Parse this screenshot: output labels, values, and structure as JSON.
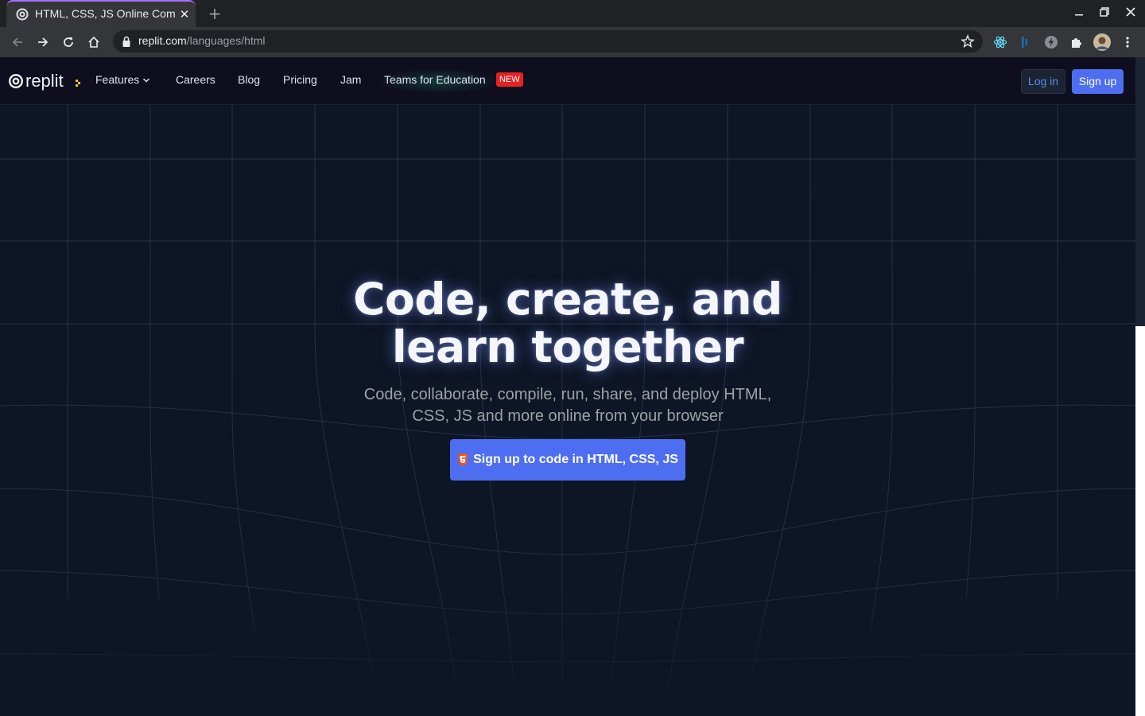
{
  "browser": {
    "tab_title": "HTML, CSS, JS Online Compiler",
    "url_host": "replit.com",
    "url_path": "/languages/html"
  },
  "nav": {
    "brand": "replit",
    "links": {
      "features": "Features",
      "careers": "Careers",
      "blog": "Blog",
      "pricing": "Pricing",
      "jam": "Jam",
      "teams": "Teams for Education"
    },
    "badge": "NEW",
    "login": "Log in",
    "signup": "Sign up"
  },
  "hero": {
    "title_line1": "Code, create, and",
    "title_line2": "learn together",
    "subtitle_line1": "Code, collaborate, compile, run, share, and deploy HTML,",
    "subtitle_line2": "CSS, JS and more online from your browser",
    "cta": "Sign up to code in HTML, CSS, JS"
  },
  "colors": {
    "page_bg": "#0e1525",
    "accent": "#4e6ef2",
    "badge": "#e52222"
  }
}
